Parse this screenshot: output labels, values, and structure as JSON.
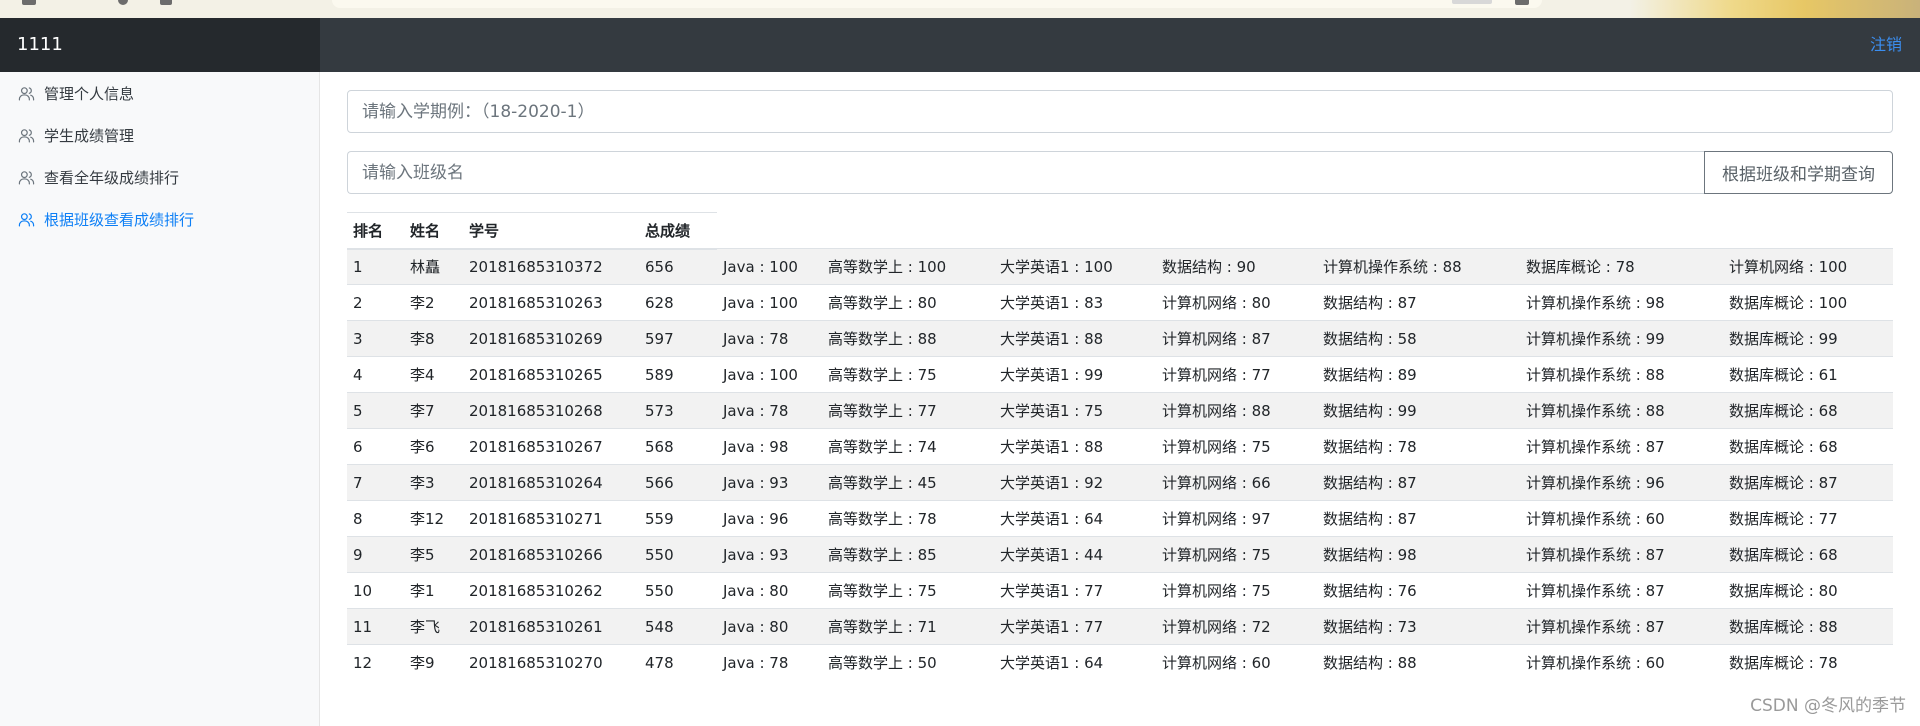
{
  "header": {
    "brand": "1111",
    "logout_label": "注销"
  },
  "sidebar": {
    "items": [
      {
        "label": "管理个人信息",
        "icon": "users-icon",
        "active": false
      },
      {
        "label": "学生成绩管理",
        "icon": "users-icon",
        "active": false
      },
      {
        "label": "查看全年级成绩排行",
        "icon": "users-icon",
        "active": false
      },
      {
        "label": "根据班级查看成绩排行",
        "icon": "users-icon",
        "active": true
      }
    ]
  },
  "search": {
    "semester_placeholder": "请输入学期例：（18-2020-1）",
    "semester_value": "",
    "class_placeholder": "请输入班级名",
    "class_value": "",
    "query_label": "根据班级和学期查询"
  },
  "table": {
    "headers": [
      "排名",
      "姓名",
      "学号",
      "总成绩"
    ],
    "rows": [
      {
        "rank": "1",
        "name": "林矗",
        "id": "20181685310372",
        "total": "656",
        "scores": [
          "Java : 100",
          "高等数学上 : 100",
          "大学英语1 : 100",
          "数据结构 : 90",
          "计算机操作系统 : 88",
          "数据库概论 : 78",
          "计算机网络 : 100"
        ]
      },
      {
        "rank": "2",
        "name": "李2",
        "id": "20181685310263",
        "total": "628",
        "scores": [
          "Java : 100",
          "高等数学上 : 80",
          "大学英语1 : 83",
          "计算机网络 : 80",
          "数据结构 : 87",
          "计算机操作系统 : 98",
          "数据库概论 : 100"
        ]
      },
      {
        "rank": "3",
        "name": "李8",
        "id": "20181685310269",
        "total": "597",
        "scores": [
          "Java : 78",
          "高等数学上 : 88",
          "大学英语1 : 88",
          "计算机网络 : 87",
          "数据结构 : 58",
          "计算机操作系统 : 99",
          "数据库概论 : 99"
        ]
      },
      {
        "rank": "4",
        "name": "李4",
        "id": "20181685310265",
        "total": "589",
        "scores": [
          "Java : 100",
          "高等数学上 : 75",
          "大学英语1 : 99",
          "计算机网络 : 77",
          "数据结构 : 89",
          "计算机操作系统 : 88",
          "数据库概论 : 61"
        ]
      },
      {
        "rank": "5",
        "name": "李7",
        "id": "20181685310268",
        "total": "573",
        "scores": [
          "Java : 78",
          "高等数学上 : 77",
          "大学英语1 : 75",
          "计算机网络 : 88",
          "数据结构 : 99",
          "计算机操作系统 : 88",
          "数据库概论 : 68"
        ]
      },
      {
        "rank": "6",
        "name": "李6",
        "id": "20181685310267",
        "total": "568",
        "scores": [
          "Java : 98",
          "高等数学上 : 74",
          "大学英语1 : 88",
          "计算机网络 : 75",
          "数据结构 : 78",
          "计算机操作系统 : 87",
          "数据库概论 : 68"
        ]
      },
      {
        "rank": "7",
        "name": "李3",
        "id": "20181685310264",
        "total": "566",
        "scores": [
          "Java : 93",
          "高等数学上 : 45",
          "大学英语1 : 92",
          "计算机网络 : 66",
          "数据结构 : 87",
          "计算机操作系统 : 96",
          "数据库概论 : 87"
        ]
      },
      {
        "rank": "8",
        "name": "李12",
        "id": "20181685310271",
        "total": "559",
        "scores": [
          "Java : 96",
          "高等数学上 : 78",
          "大学英语1 : 64",
          "计算机网络 : 97",
          "数据结构 : 87",
          "计算机操作系统 : 60",
          "数据库概论 : 77"
        ]
      },
      {
        "rank": "9",
        "name": "李5",
        "id": "20181685310266",
        "total": "550",
        "scores": [
          "Java : 93",
          "高等数学上 : 85",
          "大学英语1 : 44",
          "计算机网络 : 75",
          "数据结构 : 98",
          "计算机操作系统 : 87",
          "数据库概论 : 68"
        ]
      },
      {
        "rank": "10",
        "name": "李1",
        "id": "20181685310262",
        "total": "550",
        "scores": [
          "Java : 80",
          "高等数学上 : 75",
          "大学英语1 : 77",
          "计算机网络 : 75",
          "数据结构 : 76",
          "计算机操作系统 : 87",
          "数据库概论 : 80"
        ]
      },
      {
        "rank": "11",
        "name": "李飞",
        "id": "20181685310261",
        "total": "548",
        "scores": [
          "Java : 80",
          "高等数学上 : 71",
          "大学英语1 : 77",
          "计算机网络 : 72",
          "数据结构 : 73",
          "计算机操作系统 : 87",
          "数据库概论 : 88"
        ]
      },
      {
        "rank": "12",
        "name": "李9",
        "id": "20181685310270",
        "total": "478",
        "scores": [
          "Java : 78",
          "高等数学上 : 50",
          "大学英语1 : 64",
          "计算机网络 : 60",
          "数据结构 : 88",
          "计算机操作系统 : 60",
          "数据库概论 : 78"
        ]
      }
    ]
  },
  "watermark": "CSDN @冬风的季节",
  "colors": {
    "topbar": "#343a40",
    "brand_bg": "#25292d",
    "link": "#3b8ef0",
    "active_nav": "#0d7ff5",
    "stripe": "#f2f2f2"
  }
}
